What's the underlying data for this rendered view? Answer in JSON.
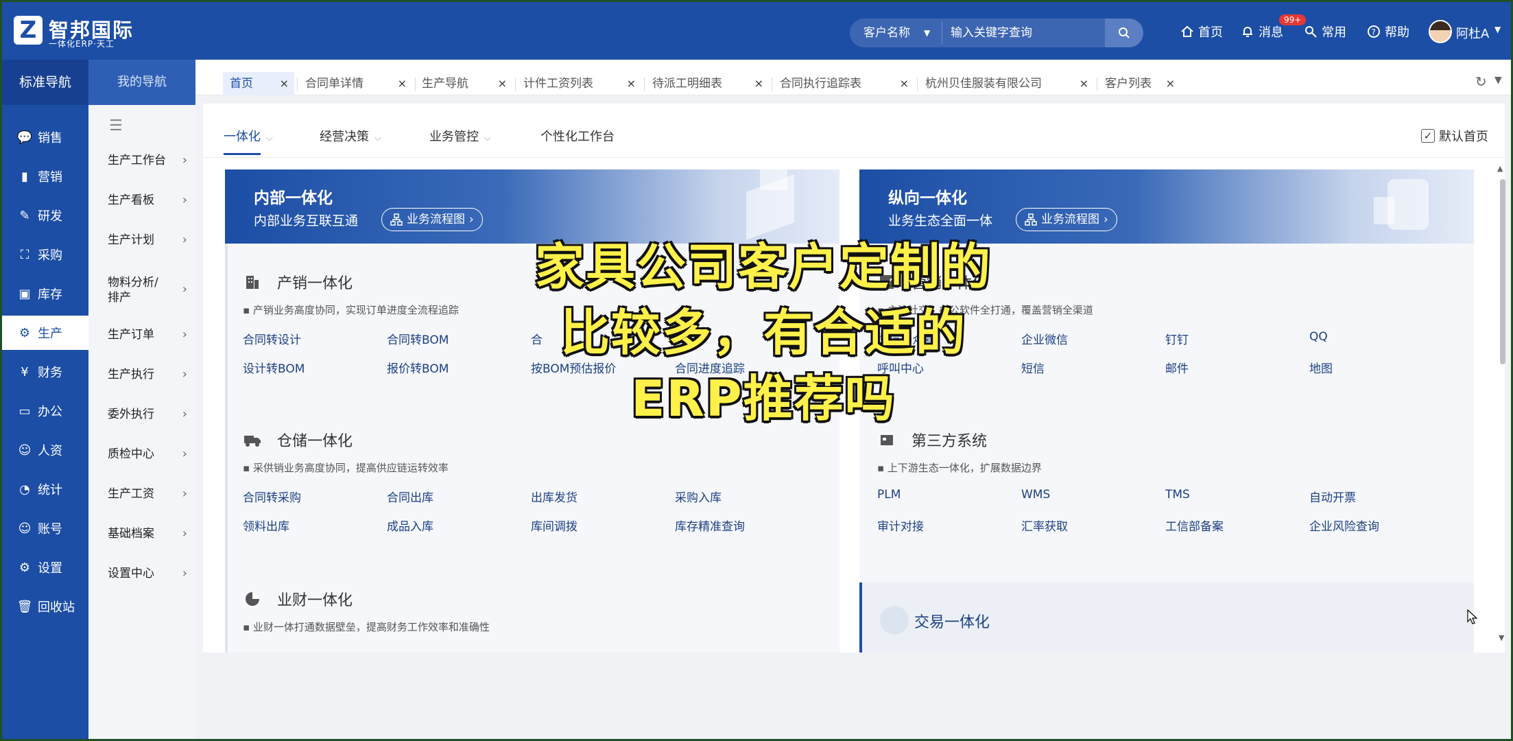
{
  "brand": {
    "logo_letter": "Z",
    "title": "智邦国际",
    "subtitle": "一体化ERP·天工"
  },
  "search": {
    "field_label": "客户名称",
    "placeholder": "输入关键字查询"
  },
  "topnav": {
    "home": "首页",
    "messages": "消息",
    "messages_badge": "99+",
    "common": "常用",
    "help": "帮助",
    "user": "阿杜A"
  },
  "leftnav": {
    "header": "标准导航",
    "items": [
      {
        "label": "销售",
        "icon": "chat-icon"
      },
      {
        "label": "营销",
        "icon": "bar-chart-icon"
      },
      {
        "label": "研发",
        "icon": "research-icon"
      },
      {
        "label": "采购",
        "icon": "basket-icon"
      },
      {
        "label": "库存",
        "icon": "inventory-icon"
      },
      {
        "label": "生产",
        "icon": "production-icon"
      },
      {
        "label": "财务",
        "icon": "yen-icon"
      },
      {
        "label": "办公",
        "icon": "briefcase-icon"
      },
      {
        "label": "人资",
        "icon": "people-icon"
      },
      {
        "label": "统计",
        "icon": "pie-icon"
      },
      {
        "label": "账号",
        "icon": "user-icon"
      },
      {
        "label": "设置",
        "icon": "gear-icon"
      },
      {
        "label": "回收站",
        "icon": "trash-icon"
      }
    ],
    "active_index": 5
  },
  "subnav": {
    "header": "我的导航",
    "items": [
      {
        "label": "生产工作台"
      },
      {
        "label": "生产看板"
      },
      {
        "label": "生产计划"
      },
      {
        "label": "物料分析/排产"
      },
      {
        "label": "生产订单"
      },
      {
        "label": "生产执行"
      },
      {
        "label": "委外执行"
      },
      {
        "label": "质检中心"
      },
      {
        "label": "生产工资"
      },
      {
        "label": "基础档案"
      },
      {
        "label": "设置中心"
      }
    ]
  },
  "tabs": [
    {
      "label": "首页",
      "active": true
    },
    {
      "label": "合同单详情"
    },
    {
      "label": "生产导航"
    },
    {
      "label": "计件工资列表"
    },
    {
      "label": "待派工明细表"
    },
    {
      "label": "合同执行追踪表"
    },
    {
      "label": "杭州贝佳服装有限公司"
    },
    {
      "label": "客户列表"
    }
  ],
  "subtabs": [
    {
      "label": "一体化",
      "active": true
    },
    {
      "label": "经营决策"
    },
    {
      "label": "业务管控"
    },
    {
      "label": "个性化工作台"
    }
  ],
  "default_home": "默认首页",
  "cards": {
    "internal": {
      "title": "内部一体化",
      "subtitle": "内部业务互联互通",
      "flow_btn": "业务流程图",
      "sections": [
        {
          "title": "产销一体化",
          "desc": "▪ 产销业务高度协同，实现订单进度全流程追踪",
          "links": [
            "合同转设计",
            "合同转BOM",
            "合",
            "设计转BOM",
            "报价转BOM",
            "按BOM预估报价",
            "合同进度追踪"
          ]
        },
        {
          "title": "仓储一体化",
          "desc": "▪ 采供销业务高度协同，提高供应链运转效率",
          "links": [
            "合同转采购",
            "合同出库",
            "出库发货",
            "采购入库",
            "领料出库",
            "成品入库",
            "库间调拨",
            "库存精准查询"
          ]
        },
        {
          "title": "业财一体化",
          "desc": "▪ 业财一体打通数据壁垒，提高财务工作效率和准确性",
          "links": []
        }
      ]
    },
    "vertical": {
      "title": "纵向一体化",
      "subtitle": "业务生态全面一体",
      "flow_btn": "业务流程图",
      "sections": [
        {
          "title": "营销一体化",
          "desc": "▪ 主流社交、办公软件全打通，覆盖营销全渠道",
          "links": [
            "微信公众号",
            "企业微信",
            "钉钉",
            "QQ",
            "呼叫中心",
            "短信",
            "邮件",
            "地图"
          ]
        },
        {
          "title": "第三方系统",
          "desc": "▪ 上下游生态一体化，扩展数据边界",
          "links": [
            "PLM",
            "WMS",
            "TMS",
            "自动开票",
            "审计对接",
            "汇率获取",
            "工信部备案",
            "企业风险查询"
          ]
        }
      ],
      "trade_title": "交易一体化"
    }
  },
  "overlay_caption": "家具公司客户定制的比较多，有合适的ERP推荐吗",
  "colors": {
    "primary": "#1c4ea6",
    "caption_fill": "#fff14a",
    "badge": "#e53935"
  }
}
